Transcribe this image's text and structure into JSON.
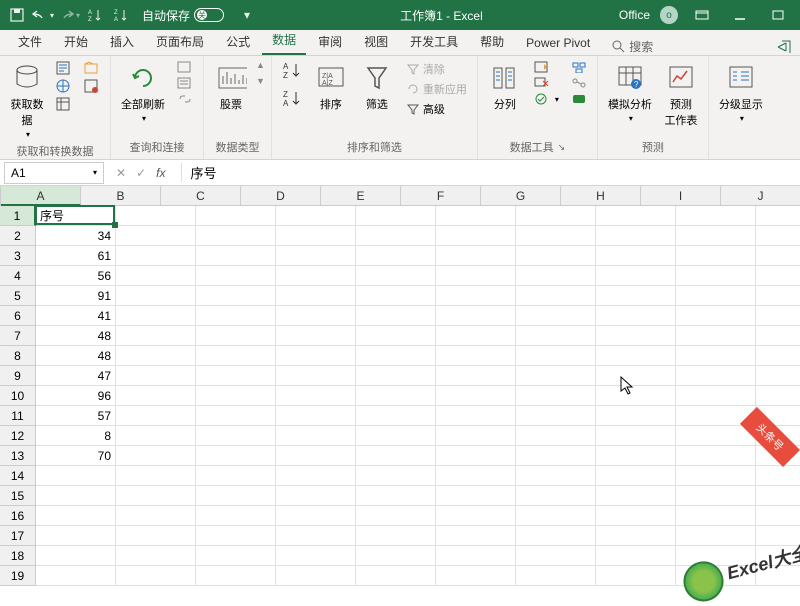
{
  "titlebar": {
    "autosave_label": "自动保存",
    "autosave_state": "关",
    "title": "工作簿1 - Excel",
    "office_label": "Office",
    "avatar": "o"
  },
  "tabs": {
    "items": [
      "文件",
      "开始",
      "插入",
      "页面布局",
      "公式",
      "数据",
      "审阅",
      "视图",
      "开发工具",
      "帮助",
      "Power Pivot"
    ],
    "active_index": 5,
    "search_label": "搜索"
  },
  "ribbon": {
    "group1": {
      "btn1": "获取数\n据",
      "label": "获取和转换数据"
    },
    "group2": {
      "btn1": "全部刷新",
      "label": "查询和连接"
    },
    "group3": {
      "btn1": "股票",
      "label": "数据类型"
    },
    "group4": {
      "btn_sort": "排序",
      "btn_filter": "筛选",
      "btn_clear": "清除",
      "btn_reapply": "重新应用",
      "btn_advanced": "高级",
      "label": "排序和筛选"
    },
    "group5": {
      "btn_split": "分列",
      "label": "数据工具"
    },
    "group6": {
      "btn1": "模拟分析",
      "btn2": "预测\n工作表",
      "label": "预测"
    },
    "group7": {
      "btn1": "分级显示",
      "label": ""
    }
  },
  "namebox": {
    "ref": "A1"
  },
  "formula": {
    "value": "序号"
  },
  "columns": [
    "A",
    "B",
    "C",
    "D",
    "E",
    "F",
    "G",
    "H",
    "I",
    "J"
  ],
  "active_col": 0,
  "active_row": 0,
  "rows": [
    {
      "n": 1,
      "cells": [
        "序号",
        "",
        "",
        "",
        "",
        "",
        "",
        "",
        "",
        ""
      ]
    },
    {
      "n": 2,
      "cells": [
        "34",
        "",
        "",
        "",
        "",
        "",
        "",
        "",
        "",
        ""
      ]
    },
    {
      "n": 3,
      "cells": [
        "61",
        "",
        "",
        "",
        "",
        "",
        "",
        "",
        "",
        ""
      ]
    },
    {
      "n": 4,
      "cells": [
        "56",
        "",
        "",
        "",
        "",
        "",
        "",
        "",
        "",
        ""
      ]
    },
    {
      "n": 5,
      "cells": [
        "91",
        "",
        "",
        "",
        "",
        "",
        "",
        "",
        "",
        ""
      ]
    },
    {
      "n": 6,
      "cells": [
        "41",
        "",
        "",
        "",
        "",
        "",
        "",
        "",
        "",
        ""
      ]
    },
    {
      "n": 7,
      "cells": [
        "48",
        "",
        "",
        "",
        "",
        "",
        "",
        "",
        "",
        ""
      ]
    },
    {
      "n": 8,
      "cells": [
        "48",
        "",
        "",
        "",
        "",
        "",
        "",
        "",
        "",
        ""
      ]
    },
    {
      "n": 9,
      "cells": [
        "47",
        "",
        "",
        "",
        "",
        "",
        "",
        "",
        "",
        ""
      ]
    },
    {
      "n": 10,
      "cells": [
        "96",
        "",
        "",
        "",
        "",
        "",
        "",
        "",
        "",
        ""
      ]
    },
    {
      "n": 11,
      "cells": [
        "57",
        "",
        "",
        "",
        "",
        "",
        "",
        "",
        "",
        ""
      ]
    },
    {
      "n": 12,
      "cells": [
        "8",
        "",
        "",
        "",
        "",
        "",
        "",
        "",
        "",
        ""
      ]
    },
    {
      "n": 13,
      "cells": [
        "70",
        "",
        "",
        "",
        "",
        "",
        "",
        "",
        "",
        ""
      ]
    },
    {
      "n": 14,
      "cells": [
        "",
        "",
        "",
        "",
        "",
        "",
        "",
        "",
        "",
        ""
      ]
    },
    {
      "n": 15,
      "cells": [
        "",
        "",
        "",
        "",
        "",
        "",
        "",
        "",
        "",
        ""
      ]
    },
    {
      "n": 16,
      "cells": [
        "",
        "",
        "",
        "",
        "",
        "",
        "",
        "",
        "",
        ""
      ]
    },
    {
      "n": 17,
      "cells": [
        "",
        "",
        "",
        "",
        "",
        "",
        "",
        "",
        "",
        ""
      ]
    },
    {
      "n": 18,
      "cells": [
        "",
        "",
        "",
        "",
        "",
        "",
        "",
        "",
        "",
        ""
      ]
    },
    {
      "n": 19,
      "cells": [
        "",
        "",
        "",
        "",
        "",
        "",
        "",
        "",
        "",
        ""
      ]
    }
  ],
  "watermark": {
    "text": "Excel大全",
    "badge": "头条号"
  }
}
